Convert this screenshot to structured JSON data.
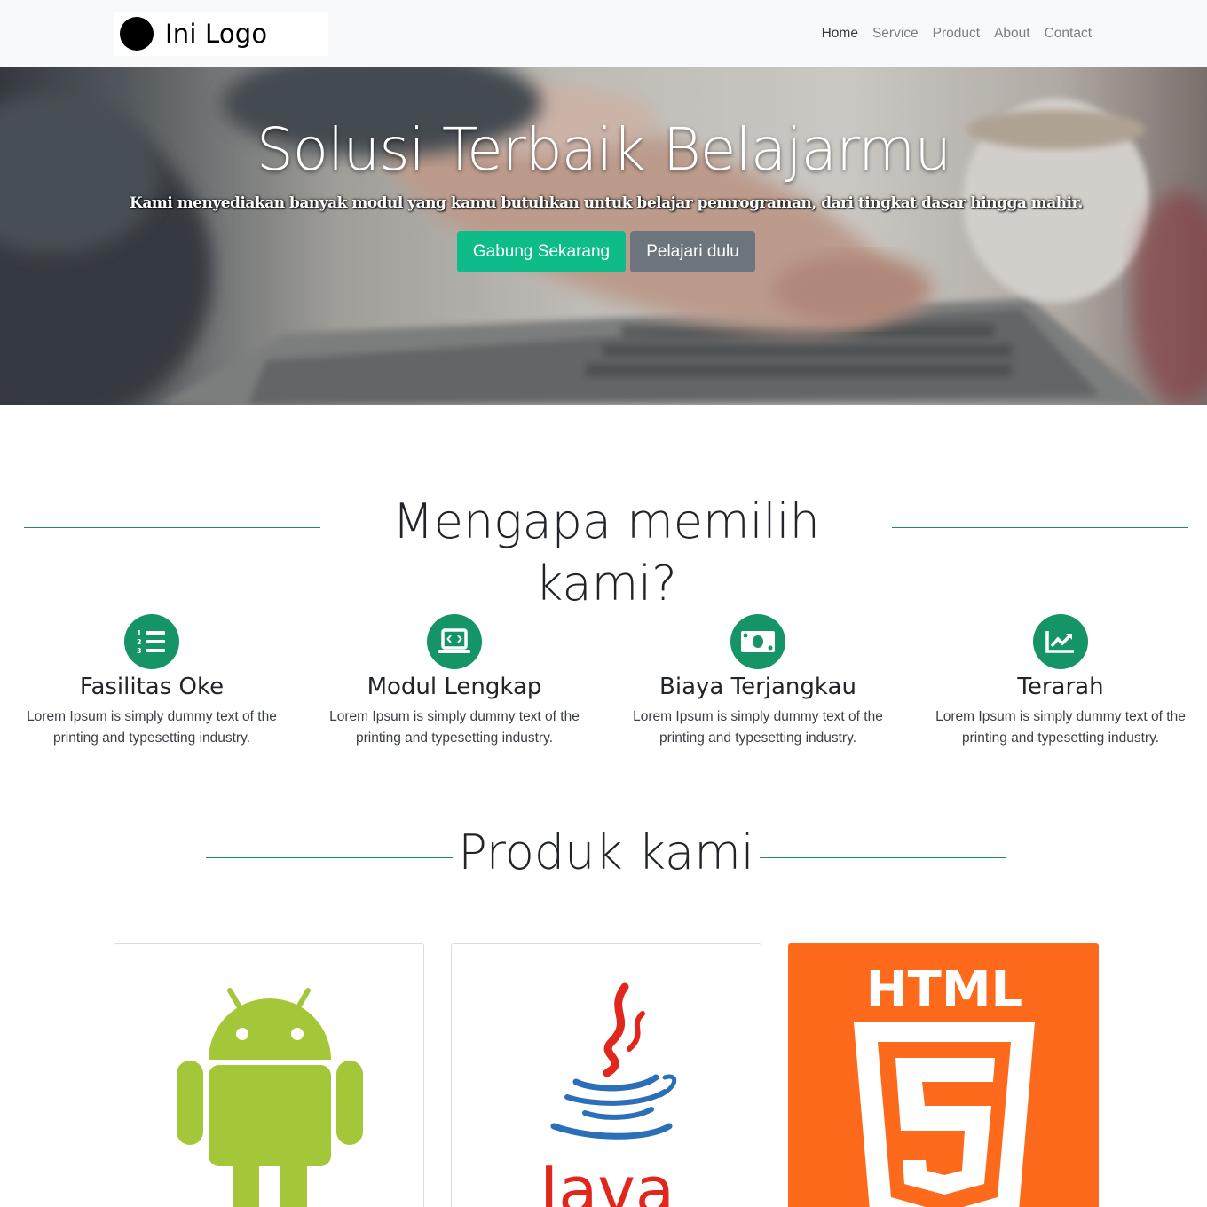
{
  "navbar": {
    "logo_text": "Ini Logo",
    "links": [
      "Home",
      "Service",
      "Product",
      "About",
      "Contact"
    ],
    "active": "Home"
  },
  "hero": {
    "title": "Solusi Terbaik Belajarmu",
    "subtitle": "Kami menyediakan banyak modul yang kamu butuhkan untuk belajar pemrograman, dari tingkat dasar hingga mahir.",
    "primary_button": "Gabung Sekarang",
    "secondary_button": "Pelajari dulu"
  },
  "why": {
    "title": "Mengapa memilih kami?",
    "features": [
      {
        "icon": "list-ol-icon",
        "title": "Fasilitas Oke",
        "desc_line1": "Lorem Ipsum is simply dummy text of the",
        "desc_line2": "printing and typesetting industry."
      },
      {
        "icon": "laptop-code-icon",
        "title": "Modul Lengkap",
        "desc_line1": "Lorem Ipsum is simply dummy text of the",
        "desc_line2": "printing and typesetting industry."
      },
      {
        "icon": "money-bill-icon",
        "title": "Biaya Terjangkau",
        "desc_line1": "Lorem Ipsum is simply dummy text of the",
        "desc_line2": "printing and typesetting industry."
      },
      {
        "icon": "chart-line-icon",
        "title": "Terarah",
        "desc_line1": "Lorem Ipsum is simply dummy text of the",
        "desc_line2": "printing and typesetting industry."
      }
    ]
  },
  "products": {
    "title": "Produk kami",
    "items": [
      {
        "name": "android-logo"
      },
      {
        "name": "java-logo",
        "label": "Java"
      },
      {
        "name": "html5-logo",
        "label": "HTML",
        "number": "5"
      }
    ]
  },
  "colors": {
    "accent": "#0dbc88",
    "icon_bg": "#159466",
    "secondary": "#6c757d",
    "android_green": "#a4c639",
    "html_orange": "#fe6a1c",
    "java_red": "#e1261c",
    "java_blue": "#2a6fb7"
  }
}
